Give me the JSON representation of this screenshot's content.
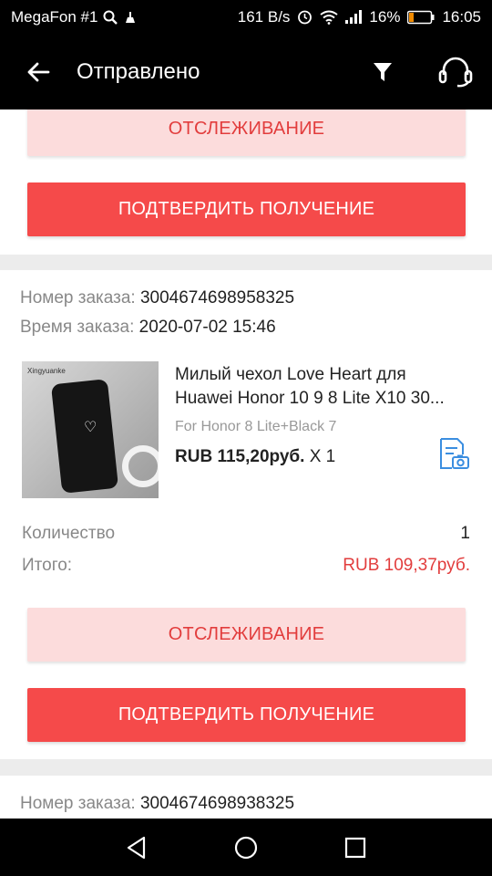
{
  "status_bar": {
    "carrier": "MegaFon #1",
    "speed": "161 B/s",
    "battery_pct": "16%",
    "time": "16:05"
  },
  "app_bar": {
    "title": "Отправлено",
    "icons": [
      "back-arrow-icon",
      "filter-icon",
      "support-headset-icon"
    ]
  },
  "orders": [
    {
      "track_label": "ОТСЛЕЖИВАНИЕ",
      "confirm_label": "ПОДТВЕРДИТЬ ПОЛУЧЕНИЕ"
    },
    {
      "order_no_label": "Номер заказа:",
      "order_no": "3004674698958325",
      "order_time_label": "Время заказа:",
      "order_time": "2020-07-02 15:46",
      "product": {
        "image_brand": "Xingyuanke",
        "title_line1": "Милый чехол Love Heart для",
        "title_line2": "Huawei Honor 10 9 8 Lite X10 30...",
        "variant": "For Honor 8 Lite+Black 7",
        "price": "RUB 115,20руб.",
        "qty": "X 1"
      },
      "quantity_label": "Количество",
      "quantity_value": "1",
      "total_label": "Итого:",
      "total_value": "RUB 109,37руб.",
      "track_label": "ОТСЛЕЖИВАНИЕ",
      "confirm_label": "ПОДТВЕРДИТЬ ПОЛУЧЕНИЕ"
    },
    {
      "order_no_label": "Номер заказа:",
      "order_no": "3004674698938325"
    }
  ],
  "colors": {
    "accent": "#f54a4a",
    "track_bg": "#fcdcdc",
    "track_text": "#e23d3d",
    "total_red": "#e23d3d"
  },
  "nav_bar": {
    "icons": [
      "back-triangle-icon",
      "home-circle-icon",
      "recents-square-icon"
    ]
  }
}
